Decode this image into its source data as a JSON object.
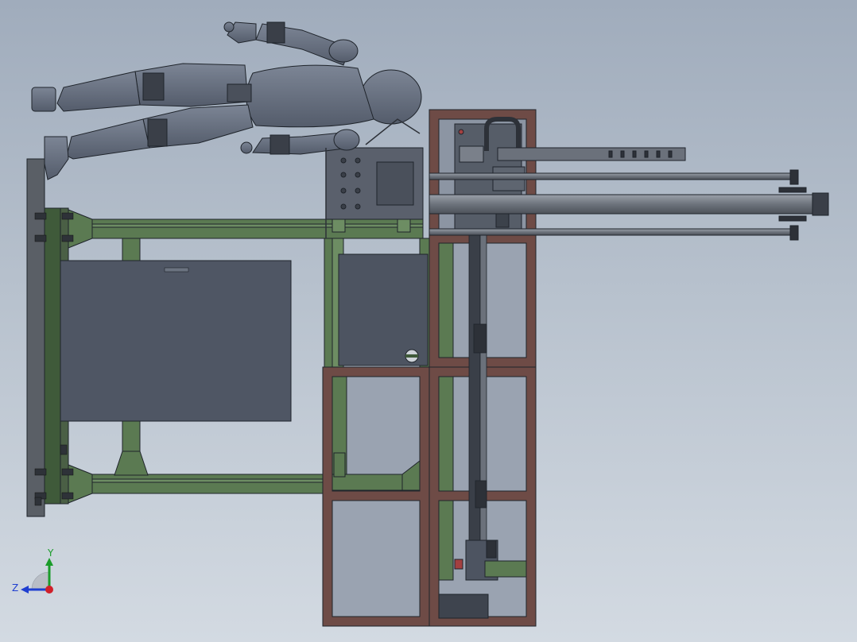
{
  "viewport": {
    "background_top": "#a0acbc",
    "background_bottom": "#d3dae2"
  },
  "colors": {
    "steel_green": "#5b7a52",
    "steel_green_light": "#6d8d63",
    "frame_brown": "#6e4b46",
    "frame_brown_light": "#85605a",
    "panel_gray": "#4f5664",
    "glass": "#9aa3b1",
    "mannequin": "#5e6676",
    "mannequin_light": "#747d8d",
    "rod": "#7d838d",
    "edge": "#1f242b"
  },
  "triad": {
    "y_label": "Y",
    "z_label": "Z",
    "y_color": "#1a9c2a",
    "z_color": "#1f3fd0",
    "x_color": "#d0202a"
  }
}
